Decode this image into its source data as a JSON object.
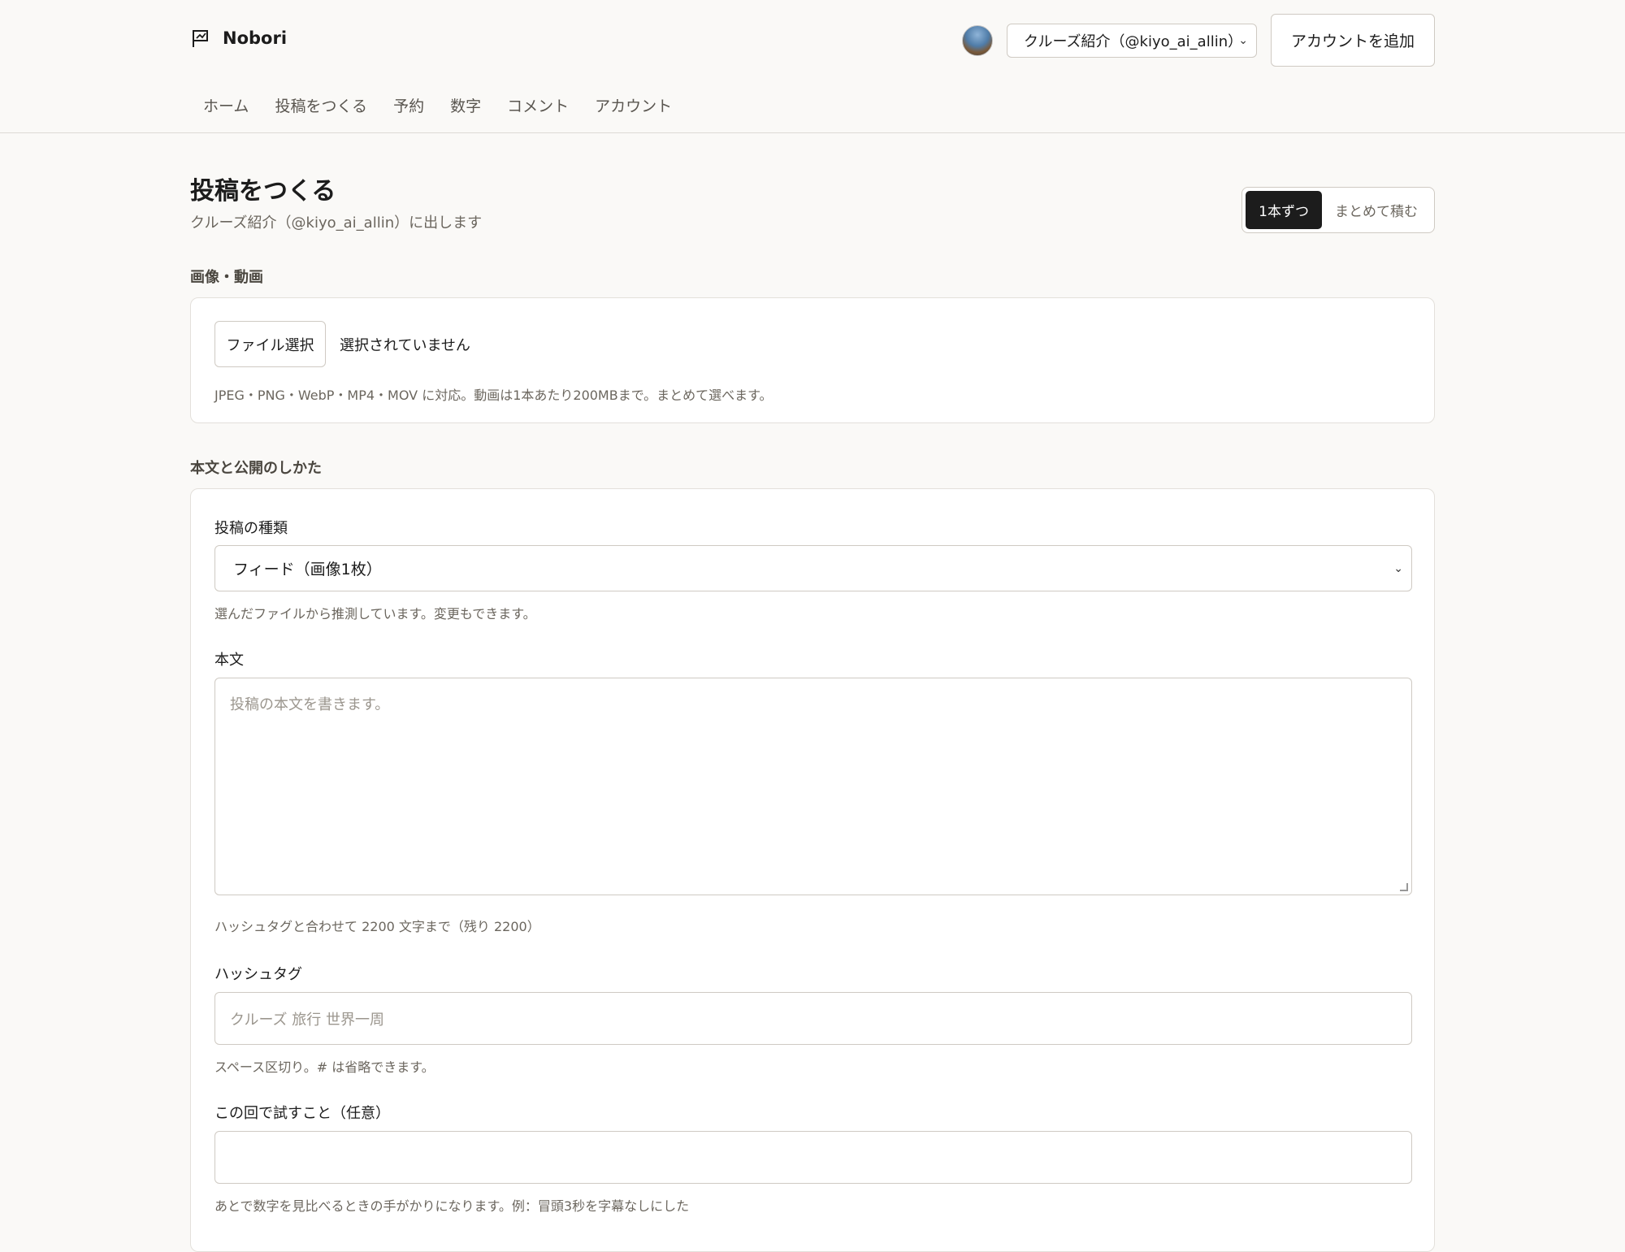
{
  "app": {
    "name": "Nobori"
  },
  "header": {
    "account_selected": "クルーズ紹介（@kiyo_ai_allin）",
    "add_account_label": "アカウントを追加"
  },
  "nav": {
    "items": [
      {
        "label": "ホーム"
      },
      {
        "label": "投稿をつくる"
      },
      {
        "label": "予約"
      },
      {
        "label": "数字"
      },
      {
        "label": "コメント"
      },
      {
        "label": "アカウント"
      }
    ]
  },
  "page": {
    "title": "投稿をつくる",
    "subtitle": "クルーズ紹介（@kiyo_ai_allin）に出します",
    "mode": {
      "single": "1本ずつ",
      "batch": "まとめて積む",
      "active": "single"
    }
  },
  "media": {
    "section_label": "画像・動画",
    "file_button": "ファイル選択",
    "file_status": "選択されていません",
    "hint": "JPEG・PNG・WebP・MP4・MOV に対応。動画は1本あたり200MBまで。まとめて選べます。"
  },
  "body_section": {
    "section_label": "本文と公開のしかた",
    "post_type": {
      "label": "投稿の種類",
      "value": "フィード（画像1枚）",
      "hint": "選んだファイルから推測しています。変更もできます。"
    },
    "caption": {
      "label": "本文",
      "placeholder": "投稿の本文を書きます。",
      "hint": "ハッシュタグと合わせて 2200 文字まで（残り 2200）"
    },
    "hashtags": {
      "label": "ハッシュタグ",
      "placeholder": "クルーズ 旅行 世界一周",
      "hint": "スペース区切り。# は省略できます。"
    },
    "experiment": {
      "label": "この回で試すこと（任意）",
      "value": "",
      "hint": "あとで数字を見比べるときの手がかりになります。例：冒頭3秒を字幕なしにした"
    }
  },
  "colors": {
    "background": "#faf9f7",
    "active_toggle": "#1c1c1c",
    "border": "#cfcac3"
  }
}
